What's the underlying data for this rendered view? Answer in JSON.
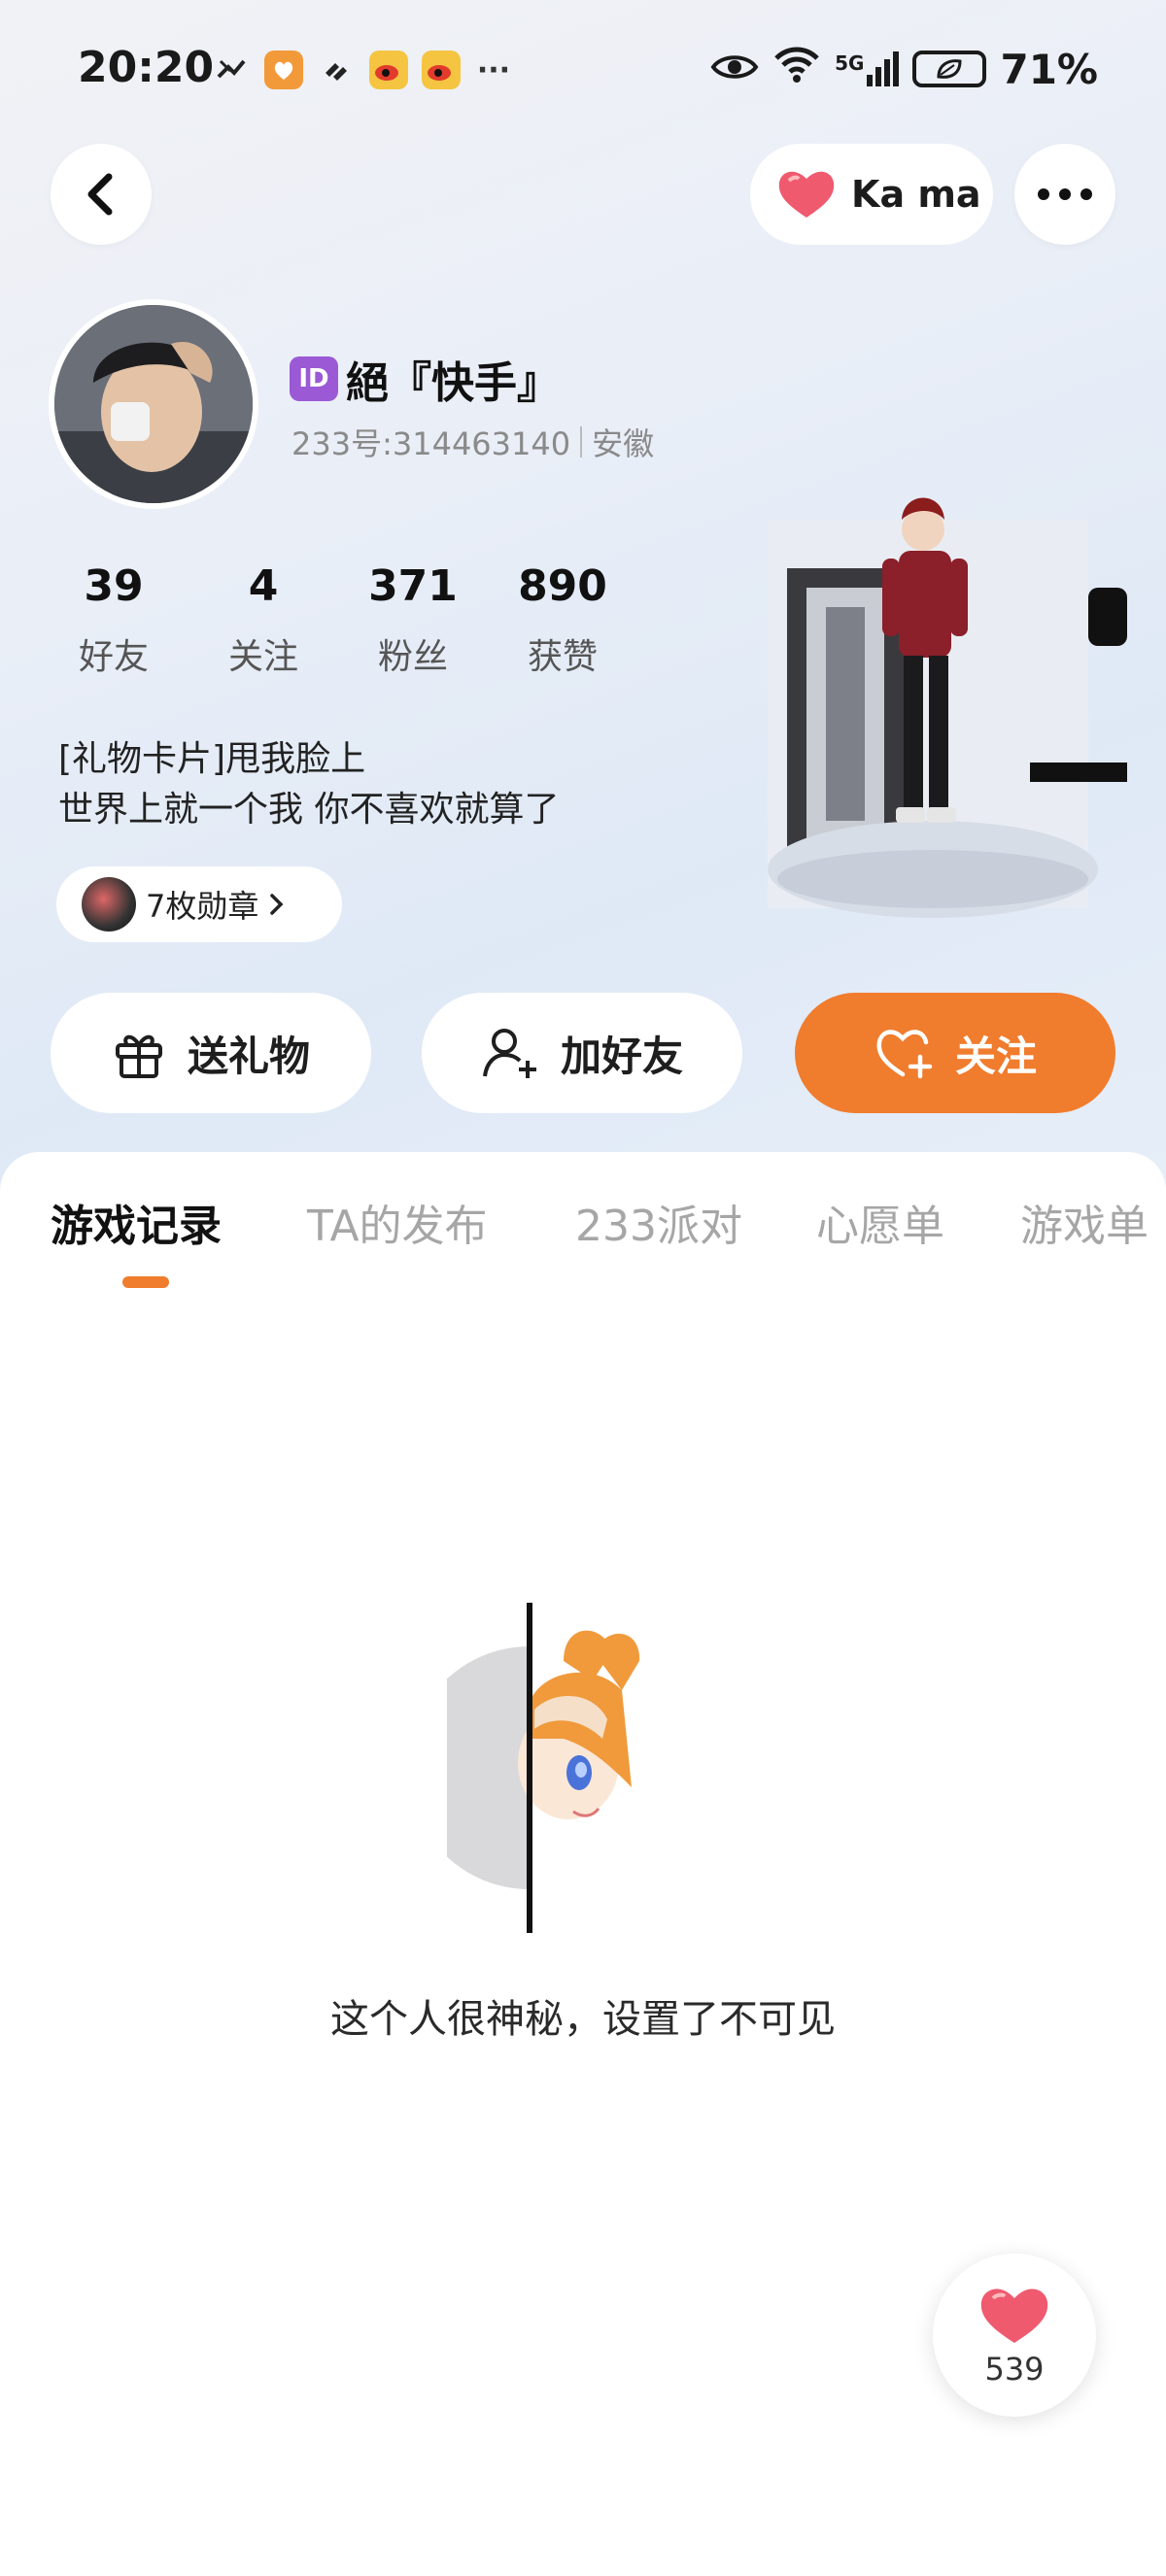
{
  "status_bar": {
    "time": "20:20",
    "network": "5G",
    "battery": "71%"
  },
  "header": {
    "kama_label": "Ka ma"
  },
  "profile": {
    "name": "絕『快手』",
    "id_badge": "ID",
    "uid": "233号:314463140",
    "location": "安徽",
    "stats": [
      {
        "value": "39",
        "label": "好友"
      },
      {
        "value": "4",
        "label": "关注"
      },
      {
        "value": "371",
        "label": "粉丝"
      },
      {
        "value": "890",
        "label": "获赞"
      }
    ],
    "bio_line1": "[礼物卡片]甩我脸上",
    "bio_line2": "世界上就一个我 你不喜欢就算了",
    "medals_label": "7枚勋章"
  },
  "actions": {
    "gift": "送礼物",
    "add_friend": "加好友",
    "follow": "关注"
  },
  "tabs": [
    {
      "label": "游戏记录"
    },
    {
      "label": "TA的发布"
    },
    {
      "label": "233派对"
    },
    {
      "label": "心愿单"
    },
    {
      "label": "游戏单"
    }
  ],
  "empty_state": {
    "message": "这个人很神秘，设置了不可见"
  },
  "like_button": {
    "count": "539"
  },
  "colors": {
    "accent": "#f07c2d",
    "id_badge": "#9b59d6",
    "heart": "#ef5a6f"
  }
}
